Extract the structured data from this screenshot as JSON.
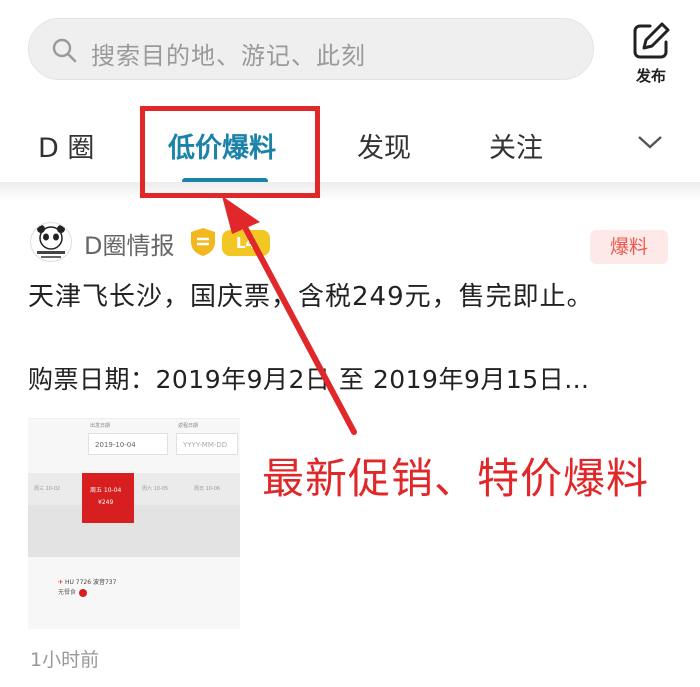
{
  "search": {
    "placeholder": "搜索目的地、游记、此刻"
  },
  "publish": {
    "label": "发布"
  },
  "tabs": [
    {
      "label": "D 圈",
      "active": false
    },
    {
      "label": "低价爆料",
      "active": true
    },
    {
      "label": "发现",
      "active": false
    },
    {
      "label": "关注",
      "active": false
    }
  ],
  "colors": {
    "accent": "#1b83aa",
    "annotation": "#e0282a",
    "tag_bg": "#fde9e7",
    "tag_text": "#ee5a4e"
  },
  "post": {
    "author": "D圈情报",
    "level_badge": "L4",
    "tag": "爆料",
    "title": "天津飞长沙，国庆票，含税249元，售完即止。",
    "subtitle": "购票日期：2019年9月2日 至 2019年9月15日…",
    "time": "1小时前",
    "thumbnail": {
      "date_field": "2019-10-04",
      "date_placeholder": "YYYY-MM-DD",
      "date_field_label": "出发日期",
      "return_field_label": "返程日期",
      "dates": [
        "周三 10-02",
        "周五 10-04",
        "周六 10-05",
        "周日 10-06"
      ],
      "selected_price": "¥249",
      "flight": "HU 7726 波音737",
      "flight_note": "无餐食"
    }
  },
  "annotation": {
    "text": "最新促销、特价爆料"
  }
}
